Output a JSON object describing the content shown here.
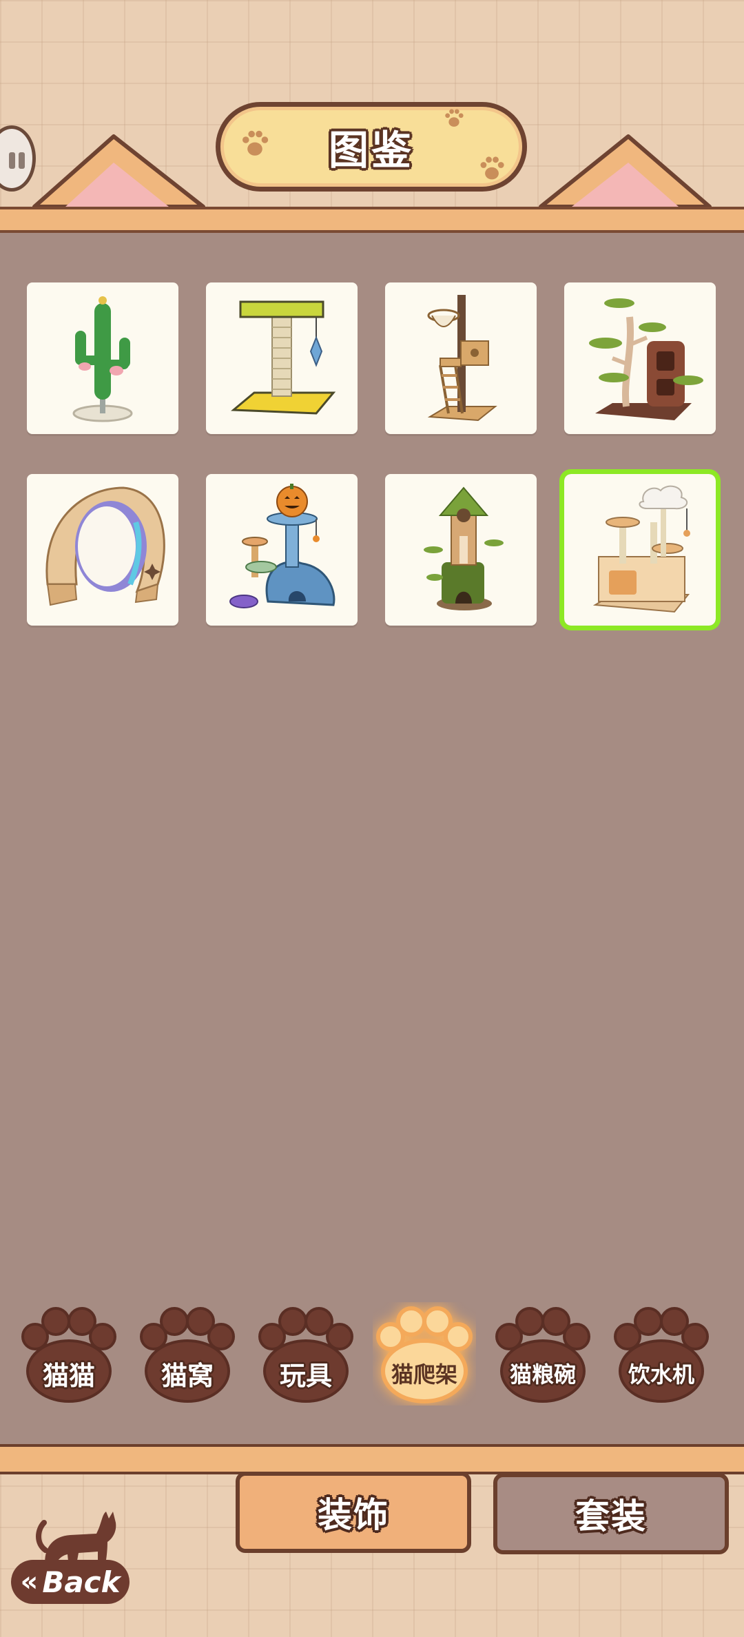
{
  "header": {
    "title": "图鉴"
  },
  "items": [
    {
      "name": "cactus-cat-tree",
      "selected": false
    },
    {
      "name": "sisal-scratching-post",
      "selected": false
    },
    {
      "name": "tall-ladder-cat-tree",
      "selected": false
    },
    {
      "name": "tree-trunk-cat-condo",
      "selected": false
    },
    {
      "name": "cat-exercise-wheel",
      "selected": false
    },
    {
      "name": "pumpkin-cat-tree",
      "selected": false
    },
    {
      "name": "mossy-tower-cat-tree",
      "selected": false
    },
    {
      "name": "cloud-platform-cat-tree",
      "selected": true
    }
  ],
  "categories": [
    {
      "label": "猫猫",
      "active": false
    },
    {
      "label": "猫窝",
      "active": false
    },
    {
      "label": "玩具",
      "active": false
    },
    {
      "label": "猫爬架",
      "active": true
    },
    {
      "label": "猫粮碗",
      "active": false
    },
    {
      "label": "饮水机",
      "active": false
    }
  ],
  "tabs": {
    "decor_label": "装饰",
    "set_label": "套装"
  },
  "back": {
    "arrow": "«",
    "label": "Back"
  },
  "colors": {
    "background": "#a68c83",
    "accent_orange": "#f0b77e",
    "outline_brown": "#6b3f2c",
    "selected_green": "#8de825",
    "paw_brown": "#6e3b2f",
    "paw_active": "#fbd79a"
  }
}
